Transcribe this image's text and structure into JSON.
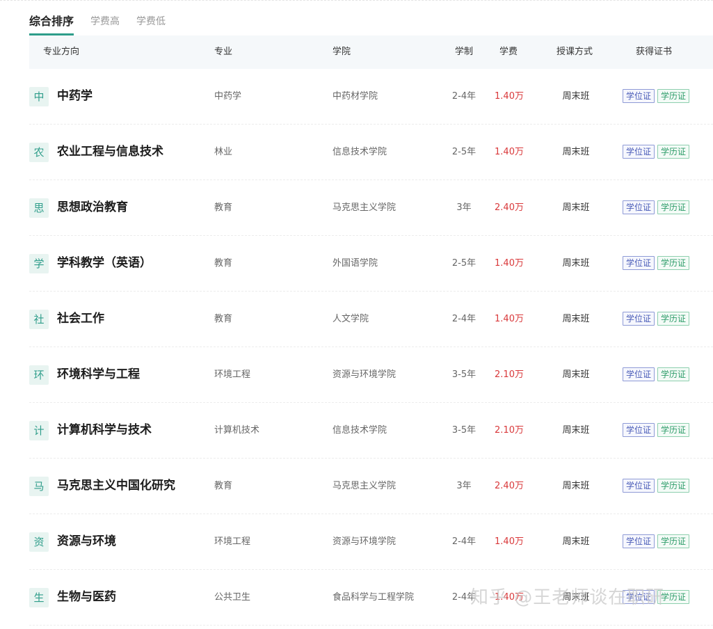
{
  "sort_tabs": [
    {
      "label": "综合排序",
      "active": true
    },
    {
      "label": "学费高",
      "active": false
    },
    {
      "label": "学费低",
      "active": false
    }
  ],
  "columns": {
    "direction": "专业方向",
    "major": "专业",
    "college": "学院",
    "duration": "学制",
    "tuition": "学费",
    "teaching_mode": "授课方式",
    "certificates": "获得证书"
  },
  "rows": [
    {
      "badge": "中",
      "direction": "中药学",
      "major": "中药学",
      "college": "中药材学院",
      "duration": "2-4年",
      "tuition": "1.40万",
      "mode": "周末班",
      "cert_degree": "学位证",
      "cert_diploma": "学历证"
    },
    {
      "badge": "农",
      "direction": "农业工程与信息技术",
      "major": "林业",
      "college": "信息技术学院",
      "duration": "2-5年",
      "tuition": "1.40万",
      "mode": "周末班",
      "cert_degree": "学位证",
      "cert_diploma": "学历证"
    },
    {
      "badge": "思",
      "direction": "思想政治教育",
      "major": "教育",
      "college": "马克思主义学院",
      "duration": "3年",
      "tuition": "2.40万",
      "mode": "周末班",
      "cert_degree": "学位证",
      "cert_diploma": "学历证"
    },
    {
      "badge": "学",
      "direction": "学科教学（英语）",
      "major": "教育",
      "college": "外国语学院",
      "duration": "2-5年",
      "tuition": "1.40万",
      "mode": "周末班",
      "cert_degree": "学位证",
      "cert_diploma": "学历证"
    },
    {
      "badge": "社",
      "direction": "社会工作",
      "major": "教育",
      "college": "人文学院",
      "duration": "2-4年",
      "tuition": "1.40万",
      "mode": "周末班",
      "cert_degree": "学位证",
      "cert_diploma": "学历证"
    },
    {
      "badge": "环",
      "direction": "环境科学与工程",
      "major": "环境工程",
      "college": "资源与环境学院",
      "duration": "3-5年",
      "tuition": "2.10万",
      "mode": "周末班",
      "cert_degree": "学位证",
      "cert_diploma": "学历证"
    },
    {
      "badge": "计",
      "direction": "计算机科学与技术",
      "major": "计算机技术",
      "college": "信息技术学院",
      "duration": "3-5年",
      "tuition": "2.10万",
      "mode": "周末班",
      "cert_degree": "学位证",
      "cert_diploma": "学历证"
    },
    {
      "badge": "马",
      "direction": "马克思主义中国化研究",
      "major": "教育",
      "college": "马克思主义学院",
      "duration": "3年",
      "tuition": "2.40万",
      "mode": "周末班",
      "cert_degree": "学位证",
      "cert_diploma": "学历证"
    },
    {
      "badge": "资",
      "direction": "资源与环境",
      "major": "环境工程",
      "college": "资源与环境学院",
      "duration": "2-4年",
      "tuition": "1.40万",
      "mode": "周末班",
      "cert_degree": "学位证",
      "cert_diploma": "学历证"
    },
    {
      "badge": "生",
      "direction": "生物与医药",
      "major": "公共卫生",
      "college": "食品科学与工程学院",
      "duration": "2-4年",
      "tuition": "1.40万",
      "mode": "周末班",
      "cert_degree": "学位证",
      "cert_diploma": "学历证"
    }
  ],
  "watermark": "知乎 @王老师谈在职研",
  "colors": {
    "accent": "#2e9d8a",
    "tuition": "#d9383a",
    "degree_tag": "#4a5cb8",
    "diploma_tag": "#2e9d6a",
    "header_bg": "#f5f8fa"
  }
}
